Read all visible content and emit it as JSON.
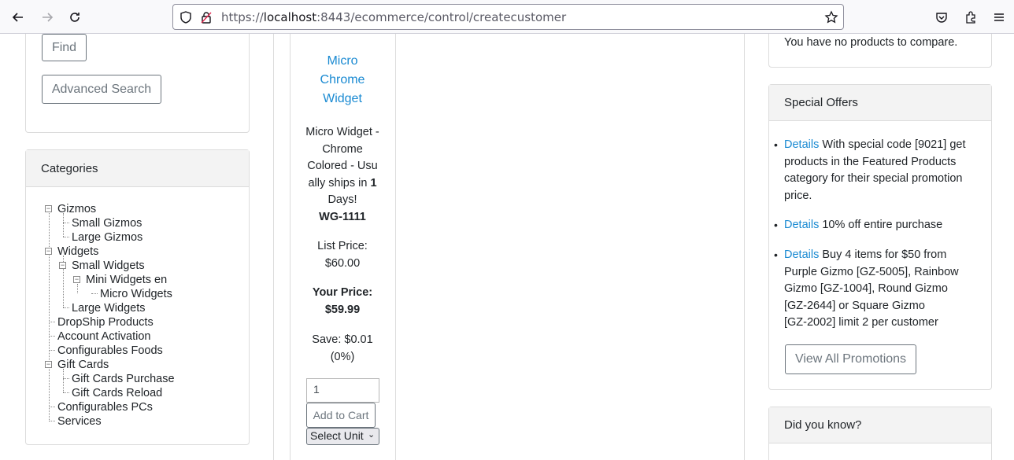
{
  "browser": {
    "url_scheme": "https://",
    "url_host": "localhost",
    "url_rest": ":8443/ecommerce/control/createcustomer"
  },
  "search": {
    "find_label": "Find",
    "advanced_label": "Advanced Search"
  },
  "categories": {
    "title": "Categories",
    "items": [
      "Gizmos",
      "Small Gizmos",
      "Large Gizmos",
      "Widgets",
      "Small Widgets",
      "Mini Widgets en",
      "Micro Widgets",
      "Large Widgets",
      "DropShip Products",
      "Account Activation",
      "Configurables Foods",
      "Gift Cards",
      "Gift Cards Purchase",
      "Gift Cards Reload",
      "Configurables PCs",
      "Services"
    ]
  },
  "product": {
    "name_lines": [
      "Micro",
      "Chrome",
      "Widget"
    ],
    "desc_lines": [
      "Micro Widget -",
      "Chrome",
      "Colored - Usu",
      "ally ships in",
      "Days!"
    ],
    "ships_days": "1",
    "sku": "WG-1111",
    "list_price_label": "List Price:",
    "list_price": "$60.00",
    "your_price_label": "Your Price:",
    "your_price": "$59.99",
    "save_label": "Save: $0.01",
    "save_pct": "(0%)",
    "qty": "1",
    "add_to_cart": "Add to Cart",
    "select_unit": "Select Unit"
  },
  "compare": {
    "text": "You have no products to compare."
  },
  "offers": {
    "title": "Special Offers",
    "details_label": "Details",
    "items": [
      [
        "With special code [9021] get",
        "products in the Featured Products",
        "category for their special promotion",
        "price."
      ],
      [
        "10% off entire purchase"
      ],
      [
        "Buy 4 items for $50 from",
        "Purple Gizmo [GZ-5005], Rainbow",
        "Gizmo [GZ-1004], Round Gizmo",
        "[GZ-2644] or Square Gizmo",
        "[GZ-2002] limit 2 per customer"
      ]
    ],
    "view_all": "View All Promotions"
  },
  "did_you_know": {
    "title": "Did you know?"
  }
}
